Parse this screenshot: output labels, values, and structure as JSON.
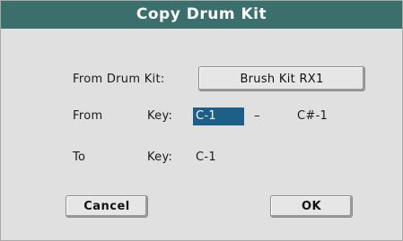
{
  "dialog": {
    "title": "Copy Drum Kit",
    "from_drum_kit_label": "From Drum Kit:",
    "from_drum_kit_value": "Brush Kit RX1",
    "from_label": "From",
    "from_key_label": "Key:",
    "from_key_start": "C-1",
    "from_key_separator": "–",
    "from_key_end": "C#-1",
    "to_label": "To",
    "to_key_label": "Key:",
    "to_key_value": "C-1",
    "cancel_label": "Cancel",
    "ok_label": "OK"
  },
  "colors": {
    "title_bar": "#3b6f6b",
    "dialog_bg": "#e0e0e0",
    "selection": "#1e5f8a"
  }
}
